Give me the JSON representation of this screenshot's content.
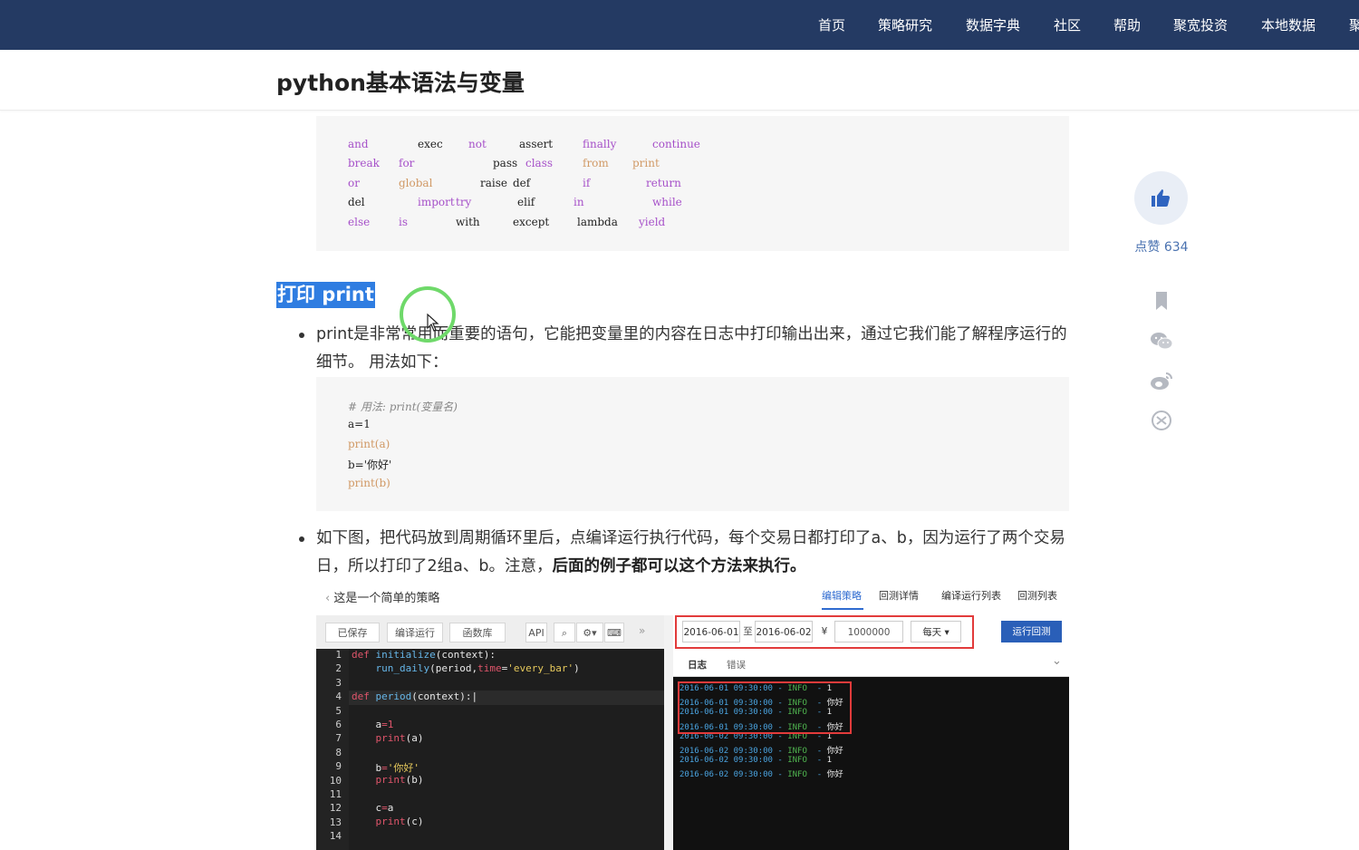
{
  "nav": {
    "items": [
      "首页",
      "策略研究",
      "数据字典",
      "社区",
      "帮助",
      "聚宽投资",
      "本地数据",
      "聚"
    ]
  },
  "page": {
    "title": "python基本语法与变量"
  },
  "keywords_block": {
    "rows": [
      [
        "and",
        "exec",
        "not",
        "assert",
        "finally",
        "continue"
      ],
      [
        "break",
        "for",
        "pass",
        "class",
        "from",
        "print"
      ],
      [
        "or",
        "global",
        "raise",
        "def",
        "if",
        "return"
      ],
      [
        "del",
        "import",
        "try",
        "elif",
        "in",
        "while"
      ],
      [
        "else",
        "is",
        "with",
        "except",
        "lambda",
        "yield"
      ]
    ]
  },
  "section": {
    "heading": "打印 print",
    "para1": "print是非常常用而重要的语句，它能把变量里的内容在日志中打印输出出来，通过它我们能了解程序运行的细节。 用法如下：",
    "code_lines": [
      "# 用法:  print(变量名)",
      "a=1",
      "print(a)",
      "b='你好'",
      "print(b)"
    ],
    "para2_normal": "如下图，把代码放到周期循环里后，点编译运行执行代码，每个交易日都打印了a、b，因为运行了两个交易日，所以打印了2组a、b。注意，",
    "para2_bold": "后面的例子都可以这个方法来执行。"
  },
  "sidebar": {
    "like_label": "点赞 634",
    "icons": [
      "bookmark-icon",
      "wechat-icon",
      "weibo-icon",
      "share-icon"
    ]
  },
  "screenshot": {
    "back_label": "这是一个简单的策略",
    "tabs": [
      "编辑策略",
      "回测详情",
      "编译运行列表",
      "回测列表"
    ],
    "toolbar": [
      "已保存",
      "编译运行",
      "函数库",
      "API"
    ],
    "start_date": "2016-06-01",
    "to_label": "至",
    "end_date": "2016-06-02",
    "currency": "¥",
    "capital": "1000000",
    "freq": "每天",
    "run_button": "运行回测",
    "log_tabs": [
      "日志",
      "错误"
    ],
    "line_numbers": [
      "1",
      "2",
      "3",
      "4",
      "5",
      "6",
      "7",
      "8",
      "9",
      "10",
      "11",
      "12",
      "13",
      "14"
    ],
    "log_lines": [
      {
        "ts": "2016-06-01 09:30:00",
        "lvl": "INFO",
        "msg": "1"
      },
      {
        "ts": "2016-06-01 09:30:00",
        "lvl": "INFO",
        "msg": "你好"
      },
      {
        "ts": "2016-06-01 09:30:00",
        "lvl": "INFO",
        "msg": "1"
      },
      {
        "ts": "2016-06-01 09:30:00",
        "lvl": "INFO",
        "msg": "你好"
      },
      {
        "ts": "2016-06-02 09:30:00",
        "lvl": "INFO",
        "msg": "1"
      },
      {
        "ts": "2016-06-02 09:30:00",
        "lvl": "INFO",
        "msg": "你好"
      },
      {
        "ts": "2016-06-02 09:30:00",
        "lvl": "INFO",
        "msg": "1"
      },
      {
        "ts": "2016-06-02 09:30:00",
        "lvl": "INFO",
        "msg": "你好"
      }
    ]
  },
  "colors": {
    "nav_bg": "#243a63",
    "accent": "#2f7de1",
    "like_blue": "#4a72b0"
  }
}
